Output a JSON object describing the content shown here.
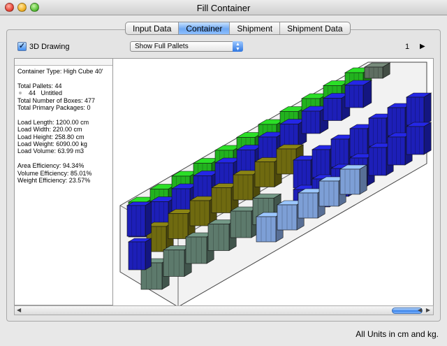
{
  "window": {
    "title": "Fill Container"
  },
  "tabs": [
    {
      "label": "Input Data",
      "active": false
    },
    {
      "label": "Container",
      "active": true
    },
    {
      "label": "Shipment",
      "active": false
    },
    {
      "label": "Shipment Data",
      "active": false
    }
  ],
  "toolbar": {
    "drawing_checkbox": {
      "label": "3D Drawing",
      "checked": true
    },
    "pallet_select": {
      "value": "Show Full Pallets"
    },
    "page_number": "1",
    "next_icon": "right-triangle-icon"
  },
  "info": {
    "container_type": "Container Type: High Cube 40'",
    "total_pallets": "Total Pallets: 44",
    "item_count": "44",
    "item_name": "Untitled",
    "total_boxes": "Total Number of Boxes: 477",
    "total_primary": "Total Primary Packages: 0",
    "load_length": "Load Length: 1200.00 cm",
    "load_width": "Load Width: 220.00 cm",
    "load_height": "Load Height: 258.80 cm",
    "load_weight": "Load Weight: 6090.00 kg",
    "load_volume": "Load Volume: 63.99 m3",
    "area_eff": "Area Efficiency: 94.34%",
    "volume_eff": "Volume Efficiency: 85.01%",
    "weight_eff": "Weight Efficiency: 23.57%"
  },
  "status": {
    "units": "All Units in cm and kg."
  },
  "colors": {
    "green": "#22b21f",
    "blue": "#1d1fb8",
    "olive": "#6f6a10",
    "slate": "#5d7a6c",
    "lightblue": "#7d9fd6",
    "selection": "#6ea9f3"
  }
}
